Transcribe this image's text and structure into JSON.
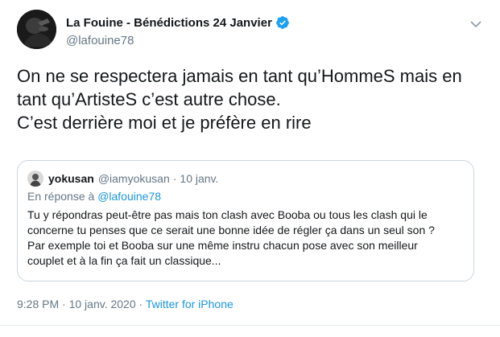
{
  "author": {
    "name": "La Fouine - Bénédictions 24 Janvier",
    "handle": "@lafouine78",
    "verified": true
  },
  "tweet": {
    "lines": [
      "On ne se respectera jamais en tant qu’HommeS mais en",
      "tant qu’ArtisteS c’est autre chose.",
      "C’est derrière moi et je préfère en rire"
    ]
  },
  "quoted_tweet": {
    "name": "yokusan",
    "handle": "@iamyokusan",
    "separator": "·",
    "date": "10 janv.",
    "reply_prefix": "En réponse à",
    "reply_handle": "@lafouine78",
    "lines": [
      "Tu y répondras peut-être pas mais ton clash avec Booba ou tous les clash qui le",
      "concerne tu penses que ce serait une bonne idée de régler ça dans un seul son ?",
      "Par exemple toi et Booba sur une même instru chacun pose avec son meilleur",
      "couplet et à la fin ça fait un classique..."
    ]
  },
  "meta": {
    "time": "9:28 PM",
    "separator1": "·",
    "date": "10 janv. 2020",
    "separator2": "·",
    "source": "Twitter for iPhone"
  },
  "colors": {
    "link": "#1b95e0",
    "verified": "#1da1f2",
    "secondary_text": "#657786",
    "border": "#ccd6dd"
  },
  "icons": {
    "verified": "verified-badge-icon",
    "more": "chevron-down-icon"
  }
}
